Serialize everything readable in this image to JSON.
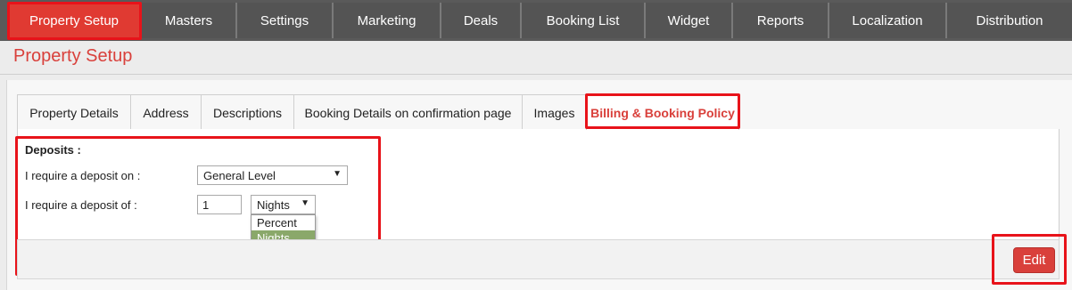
{
  "topnav": {
    "items": [
      {
        "label": "Property Setup",
        "active": true
      },
      {
        "label": "Masters"
      },
      {
        "label": "Settings"
      },
      {
        "label": "Marketing"
      },
      {
        "label": "Deals"
      },
      {
        "label": "Booking List"
      },
      {
        "label": "Widget"
      },
      {
        "label": "Reports"
      },
      {
        "label": "Localization"
      },
      {
        "label": "Distribution"
      }
    ]
  },
  "page": {
    "title": "Property Setup"
  },
  "tabs": [
    {
      "label": "Property Details"
    },
    {
      "label": "Address"
    },
    {
      "label": "Descriptions"
    },
    {
      "label": "Booking Details on confirmation page"
    },
    {
      "label": "Images"
    },
    {
      "label": "Billing & Booking Policy",
      "active": true
    }
  ],
  "deposits": {
    "heading": "Deposits :",
    "level_label": "I require a deposit on :",
    "level_value": "General Level",
    "amount_label": "I require a deposit of :",
    "amount_value": "1",
    "unit_value": "Nights",
    "unit_options": [
      "Percent",
      "Nights"
    ],
    "unit_highlighted": "Nights"
  },
  "actions": {
    "edit_label": "Edit"
  },
  "colors": {
    "nav_bg": "#545454",
    "accent": "#e03a32",
    "highlight_box": "#e8131a",
    "option_selected": "#8aa86a"
  }
}
